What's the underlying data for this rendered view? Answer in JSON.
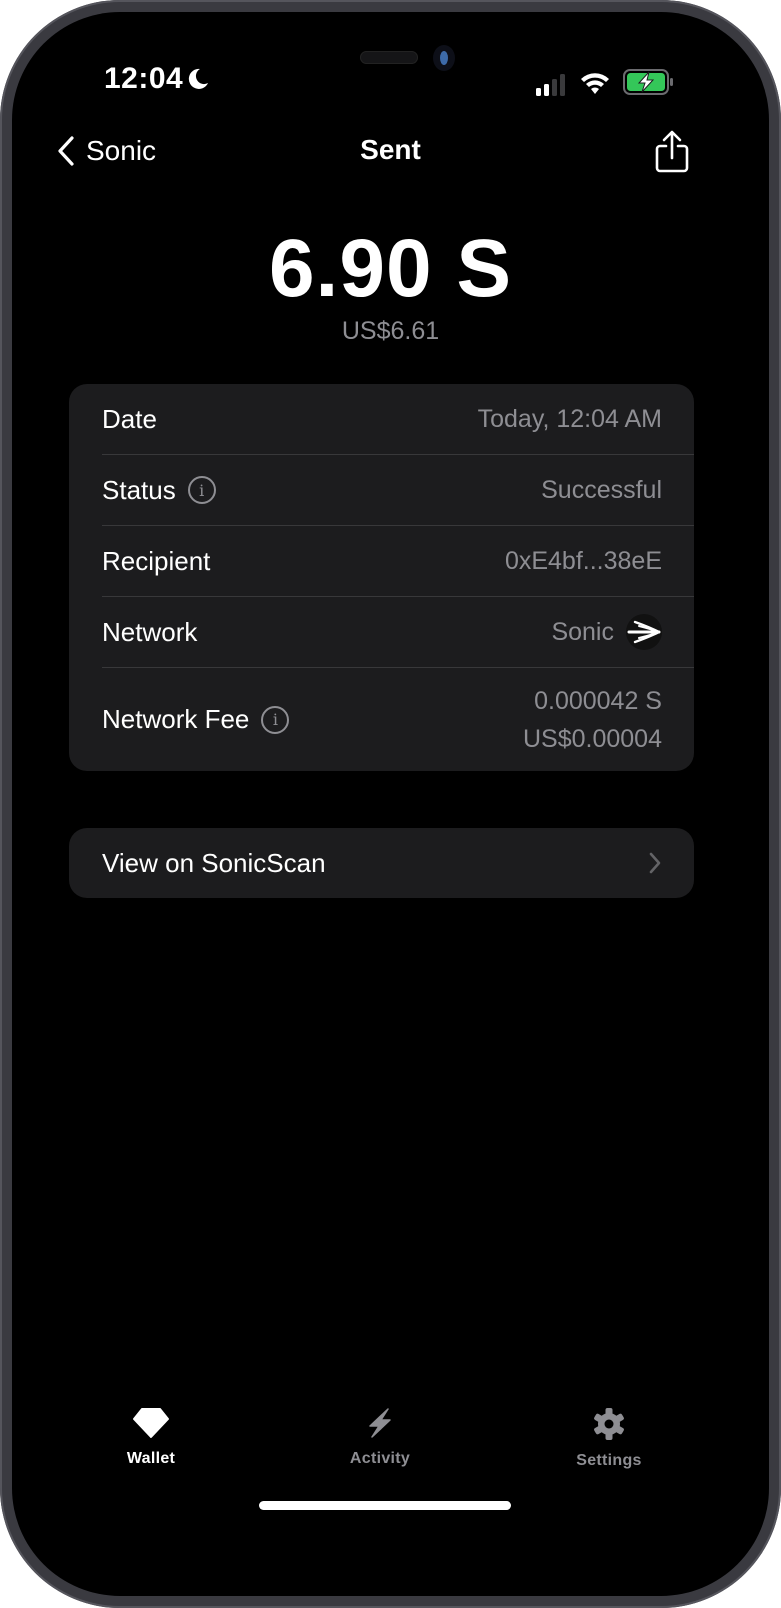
{
  "status_bar": {
    "time": "12:04",
    "focus_icon": "moon-icon",
    "signal_icon": "cellular-signal-icon",
    "wifi_icon": "wifi-icon",
    "battery_icon": "battery-charging-icon",
    "battery_color": "#34c759"
  },
  "nav": {
    "back_label": "Sonic",
    "title": "Sent",
    "back_icon": "chevron-left-icon",
    "share_icon": "share-icon"
  },
  "transaction": {
    "amount": "6.90 S",
    "fiat_amount": "US$6.61"
  },
  "details": {
    "rows": [
      {
        "label": "Date",
        "value": "Today, 12:04 AM"
      },
      {
        "label": "Status",
        "value": "Successful",
        "info_icon": "info-icon"
      },
      {
        "label": "Recipient",
        "value": "0xE4bf...38eE"
      },
      {
        "label": "Network",
        "value": "Sonic",
        "icon": "sonic-network-logo-icon"
      },
      {
        "label": "Network Fee",
        "value": "0.000042 S",
        "value_secondary": "US$0.00004",
        "info_icon": "info-icon"
      }
    ]
  },
  "explorer_link": {
    "label": "View on SonicScan",
    "icon": "chevron-right-icon"
  },
  "tab_bar": {
    "tabs": [
      {
        "label": "Wallet",
        "icon": "wallet-diamond-icon",
        "active": true
      },
      {
        "label": "Activity",
        "icon": "lightning-bolt-icon",
        "active": false
      },
      {
        "label": "Settings",
        "icon": "gear-icon",
        "active": false
      }
    ]
  },
  "colors": {
    "background": "#000000",
    "card": "#1c1c1e",
    "secondary_text": "#8e8e93",
    "separator": "#38383a"
  }
}
